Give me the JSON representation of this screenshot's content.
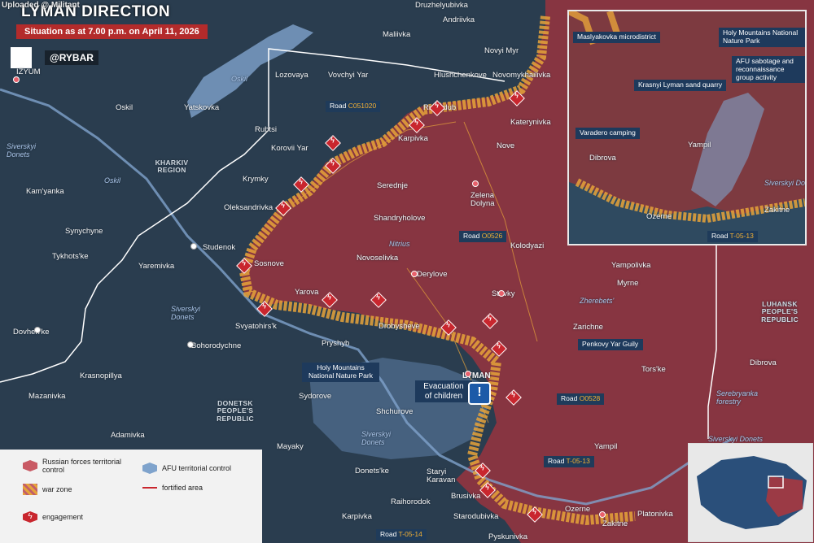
{
  "header": {
    "watermark": "Uploaded @ Militant",
    "title": "LYMAN DIRECTION",
    "subtitle": "Situation as at 7.00 p.m. on April 11, 2026",
    "brand": "@RYBAR"
  },
  "legend": {
    "russian": "Russian forces territorial control",
    "afu": "AFU territorial control",
    "warzone": "war zone",
    "fortified": "fortified area",
    "engagement": "engagement"
  },
  "colors": {
    "russian_control": "#9b3a45",
    "afu_control": "#7fa3cc",
    "war_zone": "#e6a33a",
    "engagement": "#c9262e",
    "title_bar": "#b32b2b",
    "callout": "#1e3a5c"
  },
  "towns": [
    {
      "name": "Druzhelyubivka"
    },
    {
      "name": "Andriivka"
    },
    {
      "name": "Maliivka"
    },
    {
      "name": "Novyi Myr"
    },
    {
      "name": "IZYUM"
    },
    {
      "name": "Lozovaya"
    },
    {
      "name": "Vovchyi Yar"
    },
    {
      "name": "Hlushchenkove"
    },
    {
      "name": "Novomykhailivka"
    },
    {
      "name": "Oskil"
    },
    {
      "name": "Yatskovka"
    },
    {
      "name": "Rubtsi"
    },
    {
      "name": "Ridkodub"
    },
    {
      "name": "Katerynivka"
    },
    {
      "name": "Korovii Yar"
    },
    {
      "name": "Karpivka"
    },
    {
      "name": "Nove"
    },
    {
      "name": "Krymky"
    },
    {
      "name": "Kam'yanka"
    },
    {
      "name": "Serednje"
    },
    {
      "name": "Zelena Dolyna"
    },
    {
      "name": "Oleksandrivka"
    },
    {
      "name": "Shandryholove"
    },
    {
      "name": "Synychyne"
    },
    {
      "name": "Kolodyazi"
    },
    {
      "name": "Studenok"
    },
    {
      "name": "Tykhots'ke"
    },
    {
      "name": "Sosnove"
    },
    {
      "name": "Novoselivka"
    },
    {
      "name": "Yaremivka"
    },
    {
      "name": "Derylove"
    },
    {
      "name": "Yampolivka"
    },
    {
      "name": "Yarova"
    },
    {
      "name": "Myrne"
    },
    {
      "name": "Stavky"
    },
    {
      "name": "Svyatohirs'k"
    },
    {
      "name": "Drobysheve"
    },
    {
      "name": "Zarichne"
    },
    {
      "name": "Dovhen'ke"
    },
    {
      "name": "Bohorodychne"
    },
    {
      "name": "Pryshyb"
    },
    {
      "name": "Tors'ke"
    },
    {
      "name": "Dibrova"
    },
    {
      "name": "Krasnopillya"
    },
    {
      "name": "LYMAN"
    },
    {
      "name": "Mazanivka"
    },
    {
      "name": "Sydorove"
    },
    {
      "name": "Shchurove"
    },
    {
      "name": "Adamivka"
    },
    {
      "name": "Mayaky"
    },
    {
      "name": "Yampil"
    },
    {
      "name": "Donets'ke"
    },
    {
      "name": "Staryi Karavan"
    },
    {
      "name": "Raihorodok"
    },
    {
      "name": "Brusivka"
    },
    {
      "name": "Ozerne"
    },
    {
      "name": "Karpivka"
    },
    {
      "name": "Starodubivka"
    },
    {
      "name": "Zakitne"
    },
    {
      "name": "Platonivka"
    },
    {
      "name": "Pyskunivka"
    }
  ],
  "regions": {
    "kharkiv": "KHARKIV REGION",
    "donetsk": "DONETSK PEOPLE'S REPUBLIC",
    "luhansk": "LUHANSK PEOPLE'S REPUBLIC"
  },
  "rivers": {
    "oskil_top": "Oskil",
    "oskil": "Oskil",
    "siverskyi_1": "Siverskyi Donets",
    "siverskyi_2": "Siverskyi Donets",
    "siverskyi_3": "Siverskyi Donets",
    "siverskyi_4": "Siverskyi Donets",
    "nitrius": "Nitrius",
    "zherebets": "Zherebets'",
    "serebryanka": "Serebryanka forestry"
  },
  "roads": [
    {
      "prefix": "Road",
      "code": "C051020"
    },
    {
      "prefix": "Road",
      "code": "O0526"
    },
    {
      "prefix": "Road",
      "code": "O0528"
    },
    {
      "prefix": "Road",
      "code": "T-05-13"
    },
    {
      "prefix": "Road",
      "code": "T-05-14"
    }
  ],
  "callouts": {
    "holy_mountains": "Holy Mountains National Nature Park",
    "evacuation": "Evacuation of children",
    "penkovy": "Penkovy Yar Guily"
  },
  "inset": {
    "maslyakovka": "Maslyakovka microdistrict",
    "holy_mountains": "Holy Mountains National Nature Park",
    "sabotage": "AFU sabotage and reconnaissance group activity",
    "krasnyi": "Krasnyi Lyman sand quarry",
    "varadero": "Varadero camping",
    "yampil": "Yampil",
    "dibrova": "Dibrova",
    "siverskyi": "Siverskyi Donets",
    "ozerne": "Ozerne",
    "zakitne": "Zakitne",
    "road_code": "T-05-13"
  },
  "evacuation_icon": "!"
}
